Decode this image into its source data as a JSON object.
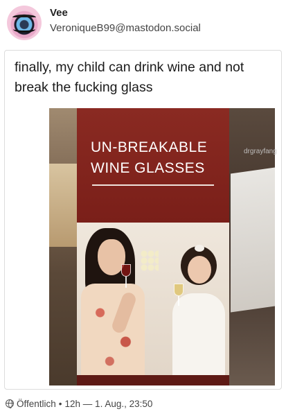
{
  "author": {
    "display_name": "Vee",
    "handle": "VeroniqueB99@mastodon.social"
  },
  "post": {
    "text": "finally, my child can drink wine and not break the fucking glass",
    "image": {
      "watermark": "drgrayfang",
      "box_title": "UN-BREAKABLE WINE GLASSES"
    }
  },
  "footer": {
    "icon": "globe-icon",
    "visibility": "Öffentlich",
    "separator": "•",
    "timestamp": "12h — 1. Aug., 23:50"
  }
}
